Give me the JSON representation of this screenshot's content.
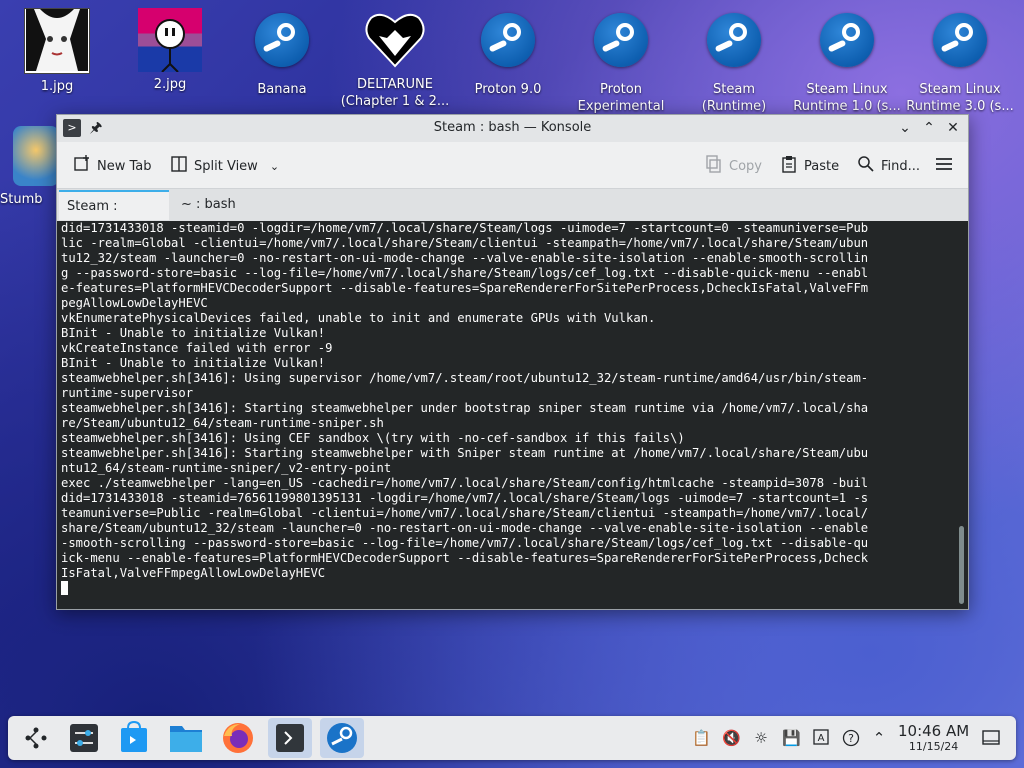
{
  "desktop": {
    "icons": [
      {
        "label": "1.jpg",
        "label2": "",
        "icon": "image-thumbnail-icon"
      },
      {
        "label": "2.jpg",
        "label2": "",
        "icon": "image-thumbnail-icon"
      },
      {
        "label": "Banana",
        "label2": "",
        "icon": "steam-icon"
      },
      {
        "label": "DELTARUNE",
        "label2": "(Chapter 1 & 2...",
        "icon": "heart-icon"
      },
      {
        "label": "Proton 9.0",
        "label2": "",
        "icon": "steam-icon"
      },
      {
        "label": "Proton",
        "label2": "Experimental",
        "icon": "steam-icon"
      },
      {
        "label": "Steam",
        "label2": "(Runtime)",
        "icon": "steam-icon"
      },
      {
        "label": "Steam Linux",
        "label2": "Runtime 1.0 (s...",
        "icon": "steam-icon"
      },
      {
        "label": "Steam Linux",
        "label2": "Runtime 3.0 (s...",
        "icon": "steam-icon"
      }
    ],
    "side_icon_label": "Stumb"
  },
  "window": {
    "title": "Steam : bash — Konsole",
    "toolbar": {
      "new_tab": "New Tab",
      "split_view": "Split View",
      "copy": "Copy",
      "paste": "Paste",
      "find": "Find..."
    },
    "tabs": [
      {
        "label": "Steam : bash",
        "active": true
      },
      {
        "label": "~ : bash",
        "active": false
      }
    ]
  },
  "terminal": {
    "lines": [
      "did=1731433018 -steamid=0 -logdir=/home/vm7/.local/share/Steam/logs -uimode=7 -startcount=0 -steamuniverse=Pub",
      "lic -realm=Global -clientui=/home/vm7/.local/share/Steam/clientui -steampath=/home/vm7/.local/share/Steam/ubun",
      "tu12_32/steam -launcher=0 -no-restart-on-ui-mode-change --valve-enable-site-isolation --enable-smooth-scrollin",
      "g --password-store=basic --log-file=/home/vm7/.local/share/Steam/logs/cef_log.txt --disable-quick-menu --enabl",
      "e-features=PlatformHEVCDecoderSupport --disable-features=SpareRendererForSitePerProcess,DcheckIsFatal,ValveFFm",
      "pegAllowLowDelayHEVC",
      "vkEnumeratePhysicalDevices failed, unable to init and enumerate GPUs with Vulkan.",
      "BInit - Unable to initialize Vulkan!",
      "vkCreateInstance failed with error -9",
      "BInit - Unable to initialize Vulkan!",
      "steamwebhelper.sh[3416]: Using supervisor /home/vm7/.steam/root/ubuntu12_32/steam-runtime/amd64/usr/bin/steam-",
      "runtime-supervisor",
      "steamwebhelper.sh[3416]: Starting steamwebhelper under bootstrap sniper steam runtime via /home/vm7/.local/sha",
      "re/Steam/ubuntu12_64/steam-runtime-sniper.sh",
      "steamwebhelper.sh[3416]: Using CEF sandbox \\(try with -no-cef-sandbox if this fails\\)",
      "steamwebhelper.sh[3416]: Starting steamwebhelper with Sniper steam runtime at /home/vm7/.local/share/Steam/ubu",
      "ntu12_64/steam-runtime-sniper/_v2-entry-point",
      "exec ./steamwebhelper -lang=en_US -cachedir=/home/vm7/.local/share/Steam/config/htmlcache -steampid=3078 -buil",
      "did=1731433018 -steamid=76561199801395131 -logdir=/home/vm7/.local/share/Steam/logs -uimode=7 -startcount=1 -s",
      "teamuniverse=Public -realm=Global -clientui=/home/vm7/.local/share/Steam/clientui -steampath=/home/vm7/.local/",
      "share/Steam/ubuntu12_32/steam -launcher=0 -no-restart-on-ui-mode-change --valve-enable-site-isolation --enable",
      "-smooth-scrolling --password-store=basic --log-file=/home/vm7/.local/share/Steam/logs/cef_log.txt --disable-qu",
      "ick-menu --enable-features=PlatformHEVCDecoderSupport --disable-features=SpareRendererForSitePerProcess,Dcheck",
      "IsFatal,ValveFFmpegAllowLowDelayHEVC"
    ]
  },
  "taskbar": {
    "time": "10:46 AM",
    "date": "11/15/24"
  },
  "colors": {
    "accent": "#3daee9",
    "terminal_bg": "#232627",
    "terminal_fg": "#fcfcfc",
    "steam_blue": "#1a73c8"
  }
}
